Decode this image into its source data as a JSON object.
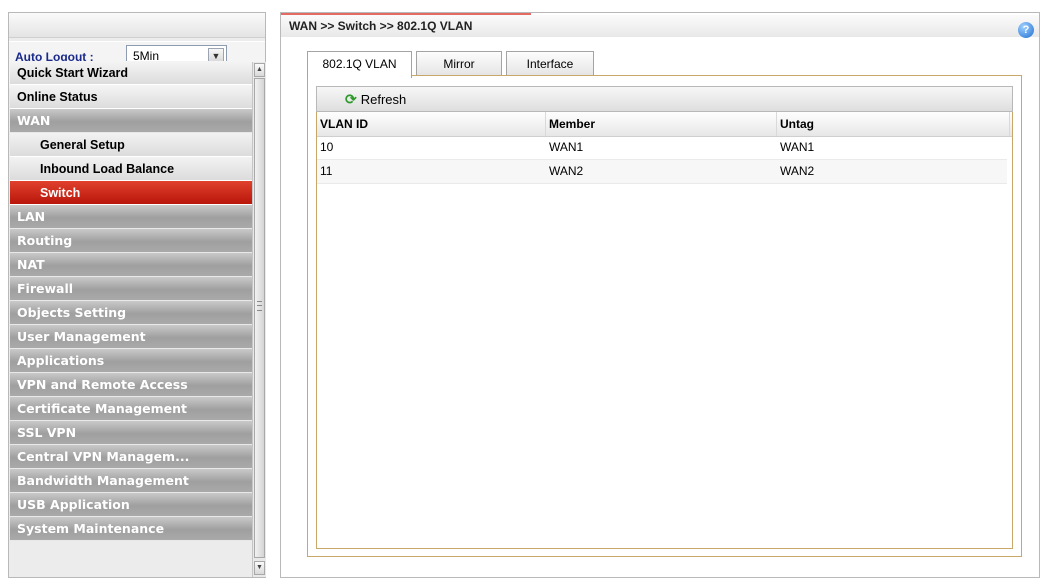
{
  "sidebar": {
    "auto_logout_label": "Auto Logout :",
    "auto_logout_value": "5Min",
    "menu": [
      {
        "label": "Quick Start Wizard",
        "style": "light"
      },
      {
        "label": "Online Status",
        "style": "light"
      },
      {
        "label": "WAN",
        "style": "dark"
      },
      {
        "label": "General Setup",
        "style": "sub"
      },
      {
        "label": "Inbound Load Balance",
        "style": "sub"
      },
      {
        "label": "Switch",
        "style": "active"
      },
      {
        "label": "LAN",
        "style": "dark"
      },
      {
        "label": "Routing",
        "style": "dark"
      },
      {
        "label": "NAT",
        "style": "dark"
      },
      {
        "label": "Firewall",
        "style": "dark"
      },
      {
        "label": "Objects Setting",
        "style": "dark"
      },
      {
        "label": "User Management",
        "style": "dark"
      },
      {
        "label": "Applications",
        "style": "dark"
      },
      {
        "label": "VPN and Remote Access",
        "style": "dark"
      },
      {
        "label": "Certificate Management",
        "style": "dark"
      },
      {
        "label": "SSL VPN",
        "style": "dark"
      },
      {
        "label": "Central VPN Managem...",
        "style": "dark"
      },
      {
        "label": "Bandwidth Management",
        "style": "dark"
      },
      {
        "label": "USB Application",
        "style": "dark"
      },
      {
        "label": "System Maintenance",
        "style": "dark"
      }
    ]
  },
  "header": {
    "breadcrumb": "WAN >> Switch >> 802.1Q VLAN",
    "help_icon": "?"
  },
  "tabs": [
    {
      "label": "802.1Q VLAN",
      "active": true
    },
    {
      "label": "Mirror",
      "active": false
    },
    {
      "label": "Interface",
      "active": false
    }
  ],
  "toolbar": {
    "refresh_label": "Refresh",
    "refresh_icon": "refresh-icon"
  },
  "table": {
    "columns": [
      "VLAN ID",
      "Member",
      "Untag"
    ],
    "rows": [
      [
        "10",
        "WAN1",
        "WAN1"
      ],
      [
        "11",
        "WAN2",
        "WAN2"
      ]
    ]
  },
  "colors": {
    "active_menu": "#c81e10",
    "menu_dark": "#a8a8a8",
    "accent_border": "#c8a86a",
    "logout_label": "#1a2a8a"
  }
}
